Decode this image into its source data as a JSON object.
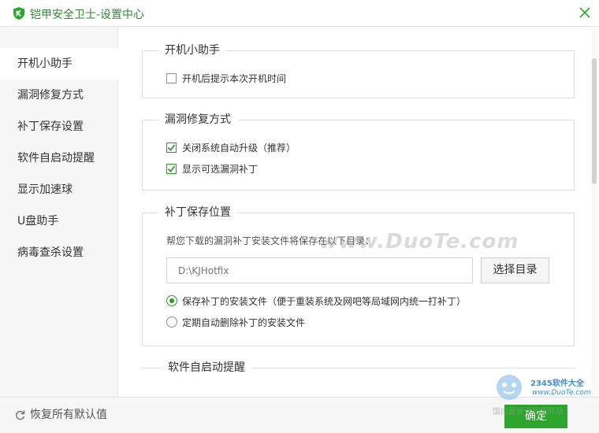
{
  "window": {
    "title": "铠甲安全卫士-设置中心"
  },
  "sidebar": {
    "items": [
      {
        "label": "开机小助手",
        "active": true
      },
      {
        "label": "漏洞修复方式",
        "active": false
      },
      {
        "label": "补丁保存设置",
        "active": false
      },
      {
        "label": "软件自启动提醒",
        "active": false
      },
      {
        "label": "显示加速球",
        "active": false
      },
      {
        "label": "U盘助手",
        "active": false
      },
      {
        "label": "病毒查杀设置",
        "active": false
      }
    ]
  },
  "sections": {
    "boot_assistant": {
      "title": "开机小助手",
      "options": [
        {
          "label": "开机后提示本次开机时间",
          "checked": false
        }
      ]
    },
    "vuln_fix": {
      "title": "漏洞修复方式",
      "options": [
        {
          "label": "关闭系统自动升级（推荐）",
          "checked": true
        },
        {
          "label": "显示可选漏洞补丁",
          "checked": true
        }
      ]
    },
    "patch_save": {
      "title": "补丁保存位置",
      "description": "帮您下载的漏洞补丁安装文件将保存在以下目录：",
      "path_value": "D:\\KJHotfix",
      "browse_label": "选择目录",
      "radios": [
        {
          "label": "保存补丁的安装文件（便于重装系统及网吧等局域网内统一打补丁）",
          "checked": true
        },
        {
          "label": "定期自动删除补丁的安装文件",
          "checked": false
        }
      ]
    },
    "autostart": {
      "title": "软件自启动提醒"
    }
  },
  "footer": {
    "restore_label": "恢复所有默认值",
    "ok_label": "确定"
  },
  "watermarks": {
    "main": "www.DuoTe.com",
    "corner_brand": "2345软件大全",
    "corner_site": "www.DuoTe.com",
    "corner_slogan": "国内最安全的软件站"
  },
  "colors": {
    "accent": "#2ca52c",
    "title_text": "#2f8a2f"
  },
  "icons": [
    "shield-logo-icon",
    "close-icon",
    "checkmark-icon",
    "refresh-icon"
  ]
}
